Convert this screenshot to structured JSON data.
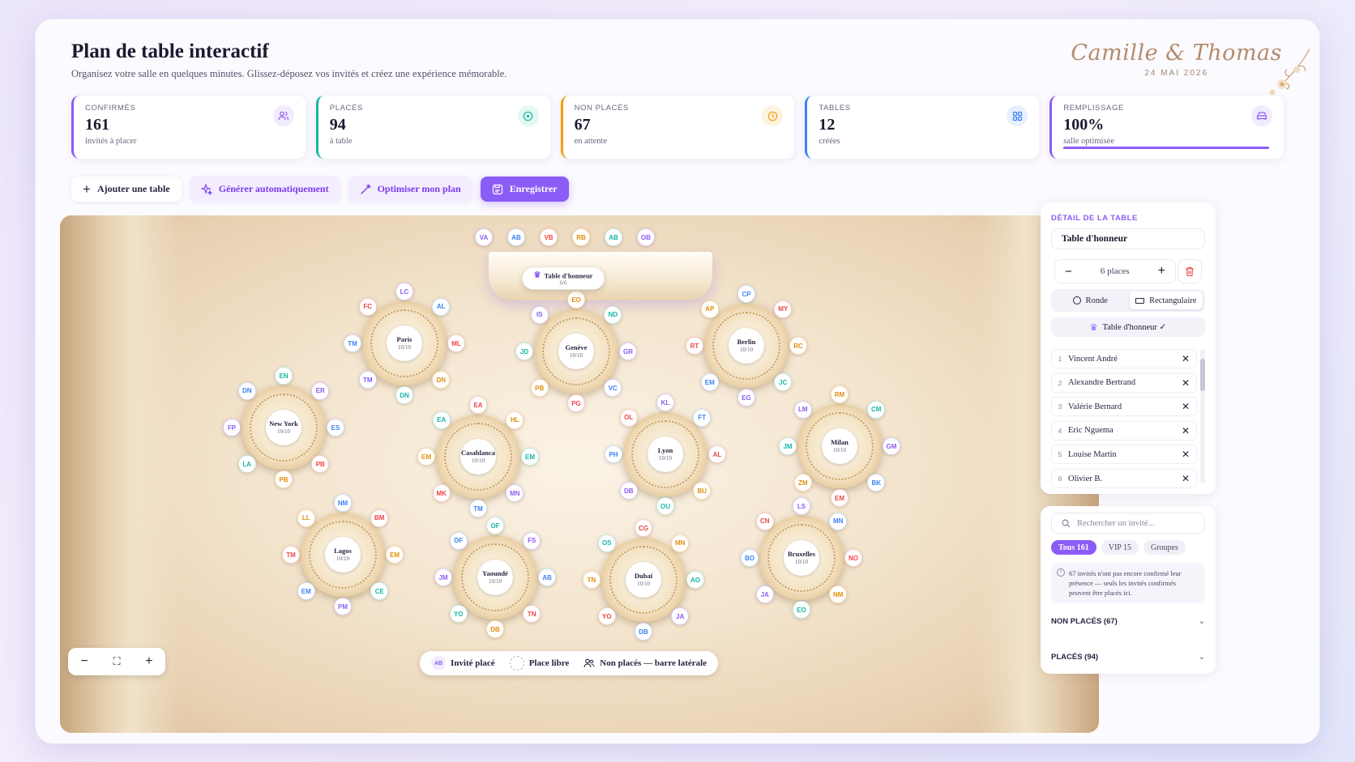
{
  "header": {
    "title": "Plan de table interactif",
    "subtitle": "Organisez votre salle en quelques minutes. Glissez-déposez vos invités et créez une expérience mémorable.",
    "couple": "Camille & Thomas",
    "date": "24 MAI 2026"
  },
  "stats": [
    {
      "label": "CONFIRMÉS",
      "value": "161",
      "sub": "invités à placer",
      "icon": "users-icon",
      "color": "#8b5cf6"
    },
    {
      "label": "PLACÉS",
      "value": "94",
      "sub": "à table",
      "icon": "check-circle-icon",
      "color": "#14b8a6"
    },
    {
      "label": "NON PLACÉS",
      "value": "67",
      "sub": "en attente",
      "icon": "clock-icon",
      "color": "#f59e0b"
    },
    {
      "label": "TABLES",
      "value": "12",
      "sub": "créées",
      "icon": "grid-icon",
      "color": "#3b82f6"
    },
    {
      "label": "REMPLISSAGE",
      "value": "100%",
      "sub": "salle optimisée",
      "icon": "sofa-icon",
      "color": "#8b5cf6",
      "progress": 1.0
    }
  ],
  "toolbar": {
    "add_table": "Ajouter une table",
    "generate": "Générer automatiquement",
    "optimize": "Optimiser mon plan",
    "save": "Enregistrer"
  },
  "honor_table": {
    "name": "Table d'honneur",
    "count": "6/6",
    "seats": [
      "VA",
      "AB",
      "VB",
      "RB",
      "AB",
      "OB"
    ]
  },
  "tables": [
    {
      "name": "Paris",
      "count": "10/10",
      "seats": [
        "LC",
        "AL",
        "ML",
        "DN",
        "DN",
        "TM",
        "TM",
        "FC"
      ]
    },
    {
      "name": "Genève",
      "count": "10/10",
      "seats": [
        "EO",
        "ND",
        "GR",
        "VC",
        "PG",
        "PB",
        "JD",
        "IS"
      ]
    },
    {
      "name": "Berlin",
      "count": "10/10",
      "seats": [
        "CP",
        "MY",
        "RC",
        "JC",
        "EG",
        "EM",
        "RT",
        "AP"
      ]
    },
    {
      "name": "New York",
      "count": "10/10",
      "seats": [
        "EN",
        "ER",
        "ES",
        "PB",
        "PB",
        "LA",
        "FP",
        "DN"
      ]
    },
    {
      "name": "Casablanca",
      "count": "10/10",
      "seats": [
        "EA",
        "HL",
        "EM",
        "MN",
        "TM",
        "MK",
        "EM",
        "EA"
      ]
    },
    {
      "name": "Lyon",
      "count": "10/10",
      "seats": [
        "KL",
        "FT",
        "AL",
        "BU",
        "OU",
        "DB",
        "PH",
        "OL"
      ]
    },
    {
      "name": "Milan",
      "count": "10/10",
      "seats": [
        "RM",
        "CM",
        "GM",
        "BK",
        "EM",
        "ZM",
        "JM",
        "LM"
      ]
    },
    {
      "name": "Lagos",
      "count": "10/10",
      "seats": [
        "NM",
        "BM",
        "EM",
        "CE",
        "PM",
        "EM",
        "TM",
        "LL"
      ]
    },
    {
      "name": "Yaoundé",
      "count": "10/10",
      "seats": [
        "OF",
        "FS",
        "AB",
        "TN",
        "DB",
        "YO",
        "JM",
        "OF"
      ]
    },
    {
      "name": "Dubaï",
      "count": "10/10",
      "seats": [
        "CG",
        "MN",
        "AO",
        "JA",
        "DB",
        "YO",
        "TN",
        "OS"
      ]
    },
    {
      "name": "Bruxelles",
      "count": "10/10",
      "seats": [
        "LS",
        "MN",
        "NO",
        "NM",
        "EO",
        "JA",
        "BO",
        "CN"
      ]
    }
  ],
  "legend": {
    "placed": "Invité placé",
    "free": "Place libre",
    "unplaced": "Non placés — barre latérale",
    "placed_sample": "AB"
  },
  "zoom": {
    "minus": "−",
    "fit": "⛶",
    "plus": "+"
  },
  "detail": {
    "section": "DÉTAIL DE LA TABLE",
    "table_name": "Table d'honneur",
    "places": "6 places",
    "shape_round": "Ronde",
    "shape_rect": "Rectangulaire",
    "honor_toggle": "Table d'honneur ✓",
    "guests": [
      {
        "n": "1",
        "name": "Vincent André"
      },
      {
        "n": "2",
        "name": "Alexandre Bertrand"
      },
      {
        "n": "3",
        "name": "Valérie Bernard"
      },
      {
        "n": "4",
        "name": "Eric Nguema"
      },
      {
        "n": "5",
        "name": "Louise Martin"
      },
      {
        "n": "6",
        "name": "Olivier B."
      }
    ]
  },
  "search": {
    "placeholder": "Rechercher un invité...",
    "filters": [
      "Tous 161",
      "VIP 15",
      "Groupes"
    ],
    "info": "67 invités n'ont pas encore confirmé leur présence — seuls les invités confirmés peuvent être placés ici.",
    "unplaced_section": "NON PLACÉS (67)",
    "placed_section": "PLACÉS (94)"
  }
}
